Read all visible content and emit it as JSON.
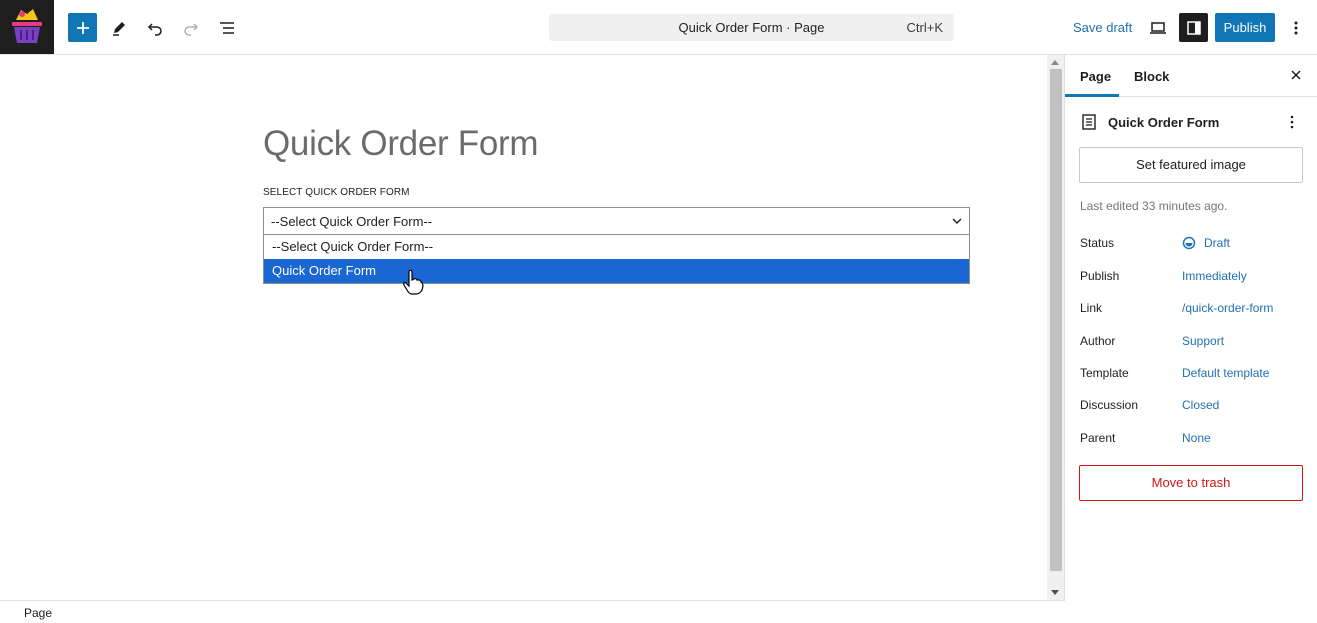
{
  "toolbar": {
    "document_title": "Quick Order Form · Page",
    "shortcut": "Ctrl+K",
    "save_draft": "Save draft",
    "publish": "Publish",
    "icons": [
      "plus-icon",
      "pen-icon",
      "undo-icon",
      "redo-icon",
      "list-view-icon",
      "desktop-icon",
      "sidebar-toggle-icon",
      "more-vertical-icon"
    ],
    "accent": "#1176b6"
  },
  "editor": {
    "page_title": "Quick Order Form",
    "field_label": "SELECT QUICK ORDER FORM",
    "select_value": "--Select Quick Order Form--",
    "options": [
      "--Select Quick Order Form--",
      "Quick Order Form"
    ],
    "highlighted_option": "Quick Order Form",
    "highlight_color": "#1a66d2"
  },
  "sidebar": {
    "tabs": [
      "Page",
      "Block"
    ],
    "active_tab": "Page",
    "doc_title": "Quick Order Form",
    "featured_image": "Set featured image",
    "last_edited": "Last edited 33 minutes ago.",
    "meta": [
      {
        "label": "Status",
        "value": "Draft"
      },
      {
        "label": "Publish",
        "value": "Immediately"
      },
      {
        "label": "Link",
        "value": "/quick-order-form"
      },
      {
        "label": "Author",
        "value": "Support"
      },
      {
        "label": "Template",
        "value": "Default template"
      },
      {
        "label": "Discussion",
        "value": "Closed"
      },
      {
        "label": "Parent",
        "value": "None"
      }
    ],
    "trash": "Move to trash",
    "link_color": "#2271b1",
    "danger_color": "#cc1818"
  },
  "footer": {
    "breadcrumb": "Page"
  }
}
